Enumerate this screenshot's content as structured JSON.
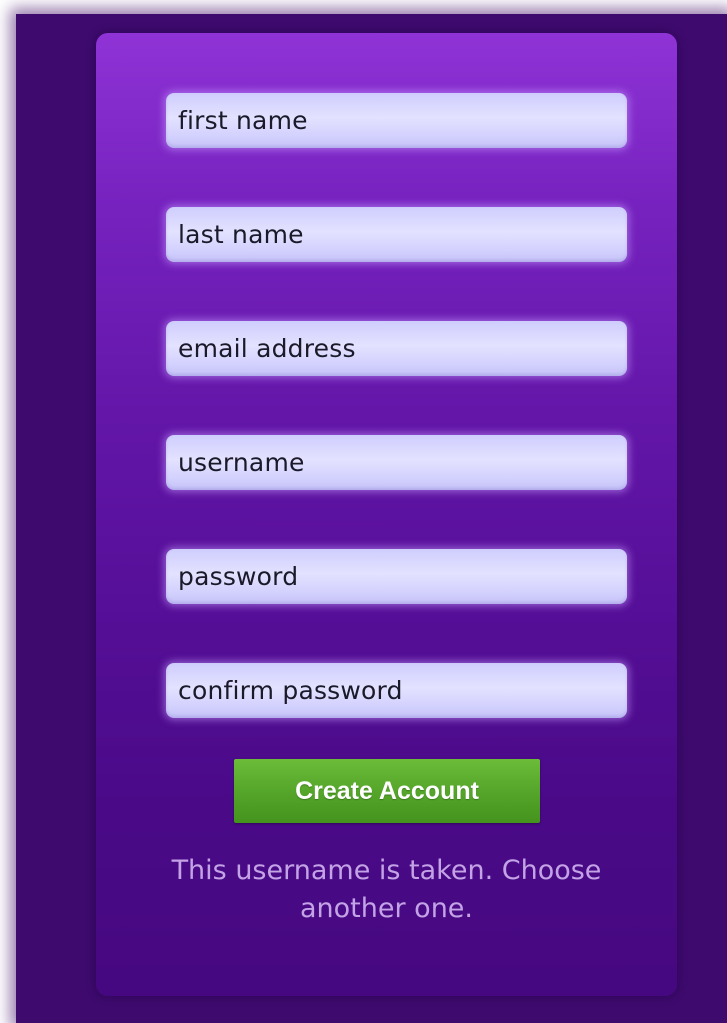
{
  "form": {
    "fields": [
      {
        "placeholder": "first name"
      },
      {
        "placeholder": "last name"
      },
      {
        "placeholder": "email address"
      },
      {
        "placeholder": "username"
      },
      {
        "placeholder": "password"
      },
      {
        "placeholder": "confirm password"
      }
    ],
    "submit_label": "Create Account",
    "error_message": "This username is taken. Choose another one."
  },
  "colors": {
    "background": "#3e0a6e",
    "panel_top": "#8f33d6",
    "panel_bottom": "#460880",
    "field": "#dcdaff",
    "button": "#55a62a",
    "message_text": "#c3a2e6"
  }
}
